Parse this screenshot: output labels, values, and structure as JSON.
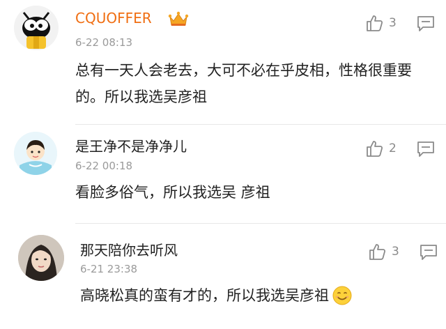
{
  "accent_colors": {
    "vip_username": "#f06e12",
    "normal_username": "#222222",
    "meta_text": "#9a9a9a",
    "icon_grey": "#8a8a8a"
  },
  "comments": [
    {
      "username": "CQUOFFER",
      "badge": "crown-icon",
      "time": "6-22 08:13",
      "text": "总有一天人会老去，大可不必在乎皮相，性格很重要的。所以我选吴彦祖",
      "likes": "3"
    },
    {
      "username": "是王净不是净净儿",
      "time": "6-22 00:18",
      "text": "看脸多俗气，所以我选吴 彦祖",
      "likes": "2"
    },
    {
      "username": "那天陪你去听风",
      "time": "6-21 23:38",
      "text": "高晓松真的蛮有才的，所以我选吴彦祖",
      "likes": "3",
      "emoji": "smile-emoji-icon"
    }
  ]
}
